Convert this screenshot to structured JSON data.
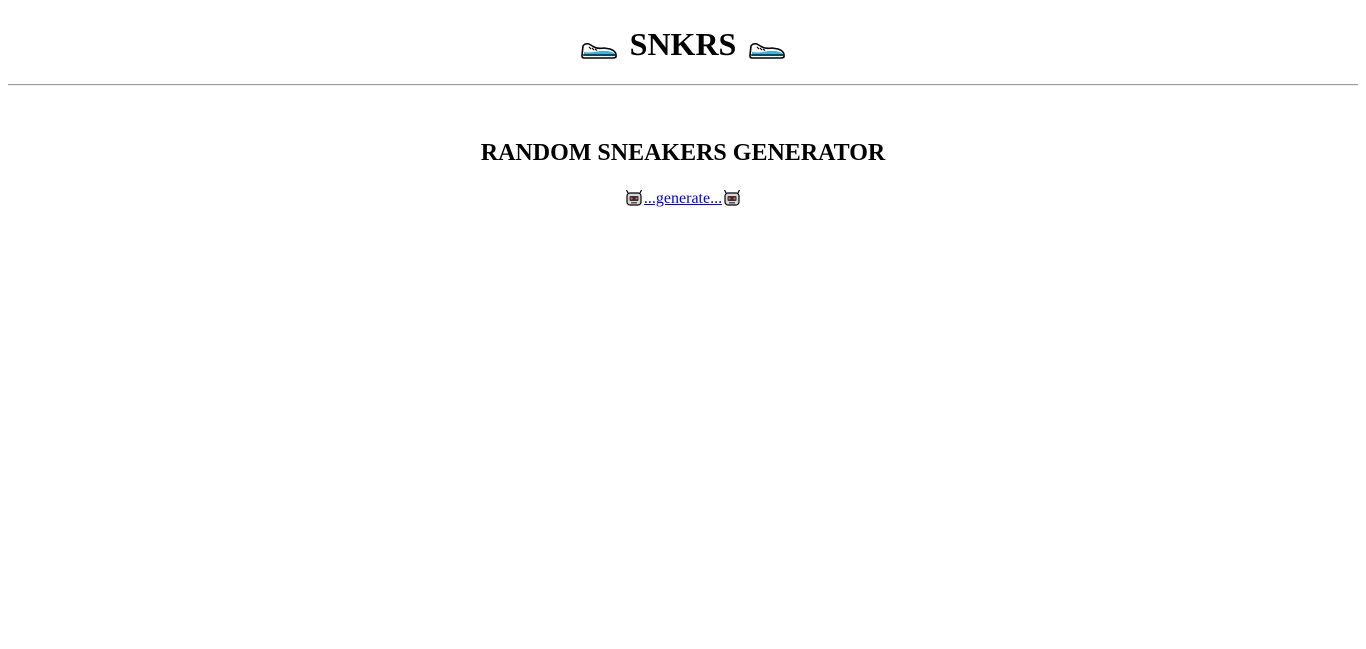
{
  "header": {
    "title": "SNKRS",
    "left_icon": "sneaker-icon",
    "right_icon": "sneaker-icon"
  },
  "main": {
    "heading": "RANDOM SNEAKERS GENERATOR",
    "generate_link": {
      "label": "...generate...",
      "left_icon": "robot-icon",
      "right_icon": "robot-icon"
    }
  },
  "colors": {
    "link": "#0000ee",
    "divider": "#9a9a9a",
    "shoe_accent": "#3ab7e0"
  }
}
